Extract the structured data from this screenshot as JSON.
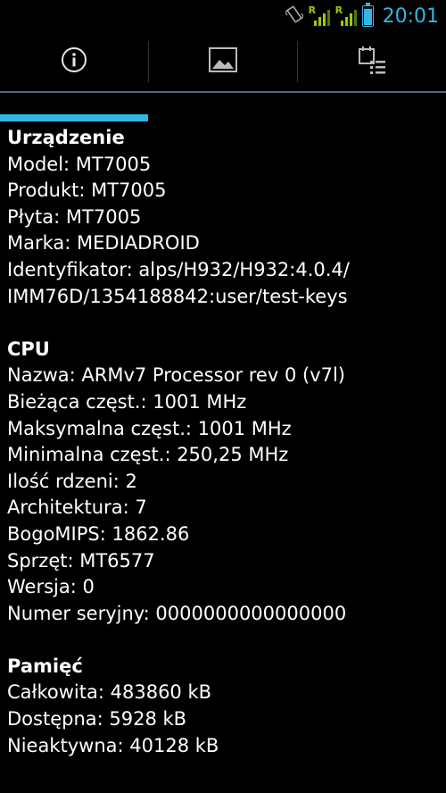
{
  "statusbar": {
    "time": "20:01",
    "sim1_label": "R",
    "sim2_label": "R",
    "signal1_bars": 4,
    "signal2_bars": 4,
    "battery_level_pct": 80,
    "icons": [
      "vibrate-icon",
      "signal-icon",
      "signal-icon",
      "battery-icon"
    ],
    "accent_color": "#33b5e5",
    "signal_color": "#99cc00"
  },
  "tabs": [
    {
      "icon": "info-icon",
      "selected": true
    },
    {
      "icon": "image-icon",
      "selected": false
    },
    {
      "icon": "calendar-list-icon",
      "selected": false
    }
  ],
  "device": {
    "title": "Urządzenie",
    "lines": [
      "Model: MT7005",
      "Produkt: MT7005",
      "Płyta: MT7005",
      "Marka: MEDIADROID",
      "Identyfikator: alps/H932/H932:4.0.4/",
      "IMM76D/1354188842:user/test-keys"
    ]
  },
  "cpu": {
    "title": "CPU",
    "lines": [
      "Nazwa: ARMv7 Processor rev 0 (v7l)",
      "Bieżąca częst.: 1001 MHz",
      "Maksymalna częst.: 1001 MHz",
      "Minimalna częst.: 250,25 MHz",
      "Ilość rdzeni: 2",
      "Architektura: 7",
      "BogoMIPS: 1862.86",
      "Sprzęt: MT6577",
      "Wersja: 0",
      "Numer seryjny: 0000000000000000"
    ]
  },
  "memory": {
    "title": "Pamięć",
    "lines": [
      "Całkowita: 483860 kB",
      "Dostępna: 5928 kB",
      "Nieaktywna: 40128 kB"
    ]
  }
}
